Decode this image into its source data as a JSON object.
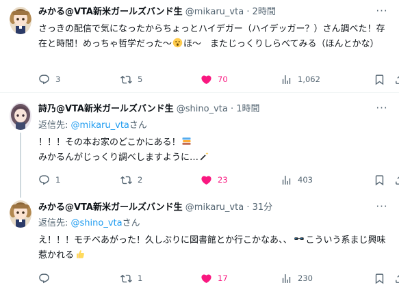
{
  "tweets": [
    {
      "name": "みかる@VTA新米ガールズバンド生",
      "handle": "@mikaru_vta",
      "dot": "·",
      "time": "2時間",
      "text_1": "さっきの配信で気になったからちょっとハイデガー（ハイデッガー？）さん調べた！存在と時間！めっちゃ哲学だった〜",
      "text_2": "ほ〜　またじっくりしらべてみる（ほんとかな）",
      "emoji_name": "hushed-face-emoji",
      "replies": "3",
      "retweets": "5",
      "likes": "70",
      "views": "1,062"
    },
    {
      "name": "詩乃@VTA新米ガールズバンド生",
      "handle": "@shino_vta",
      "dot": "·",
      "time": "1時間",
      "reply_label": "返信先: ",
      "reply_mention": "@mikaru_vta",
      "reply_suffix": "さん",
      "text_1": "！！！その本お家のどこかにある！",
      "text_2": "みかるんがじっくり調べしますように…",
      "emoji_1_name": "books-emoji",
      "emoji_2_name": "magic-wand-emoji",
      "replies": "1",
      "retweets": "2",
      "likes": "23",
      "views": "403"
    },
    {
      "name": "みかる@VTA新米ガールズバンド生",
      "handle": "@mikaru_vta",
      "dot": "·",
      "time": "31分",
      "reply_label": "返信先: ",
      "reply_mention": "@shino_vta",
      "reply_suffix": "さん",
      "text_1": "え！！！モチベあがった！久しぶりに図書館とか行こかなあ、、",
      "text_2": "こういう系まじ興味惹かれる",
      "emoji_1_name": "sunglasses-emoji",
      "emoji_2_name": "thumbs-up-emoji",
      "replies": "",
      "retweets": "1",
      "likes": "17",
      "views": "230"
    }
  ],
  "colors": {
    "like_pink": "#f91880",
    "link_blue": "#1d9bf0",
    "muted_gray": "#536471"
  }
}
